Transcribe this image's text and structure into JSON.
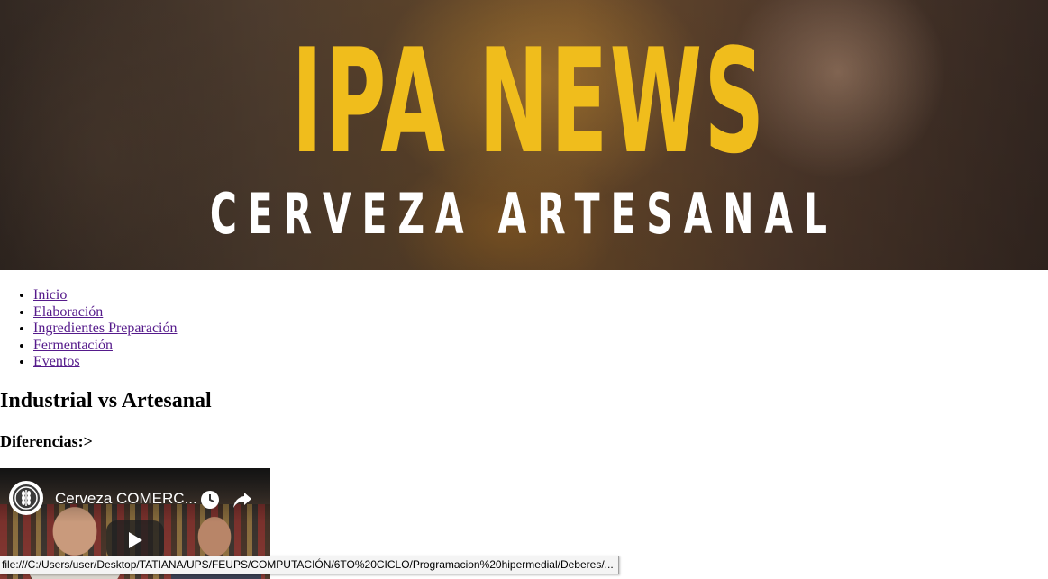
{
  "banner": {
    "title": "IPA NEWS",
    "subtitle": "CERVEZA ARTESANAL"
  },
  "nav": {
    "items": [
      {
        "label": "Inicio"
      },
      {
        "label": "Elaboración"
      },
      {
        "label": "Ingredientes Preparación"
      },
      {
        "label": "Fermentación"
      },
      {
        "label": "Eventos"
      }
    ]
  },
  "main": {
    "heading": "Industrial vs Artesanal",
    "subheading": "Diferencias:>"
  },
  "video": {
    "title": "Cerveza COMERC...",
    "icons": [
      "wheat-logo-icon",
      "clock-icon",
      "share-icon",
      "play-icon"
    ]
  },
  "statusbar": {
    "url": "file:///C:/Users/user/Desktop/TATIANA/UPS/FEUPS/COMPUTACIÓN/6TO%20CICLO/Programacion%20hipermedial/Deberes/..."
  },
  "colors": {
    "title_yellow": "#f0bd1c",
    "visited_link": "#551a8b"
  }
}
